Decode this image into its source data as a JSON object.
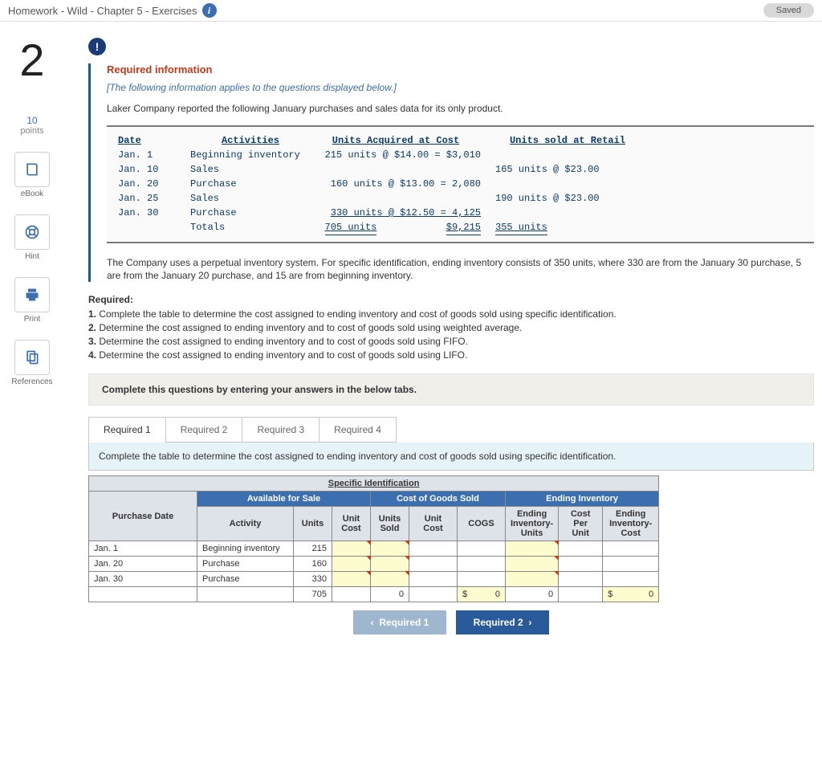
{
  "header": {
    "title": "Homework - Wild - Chapter 5 - Exercises",
    "saved": "Saved"
  },
  "side": {
    "qnum": "2",
    "points": "10",
    "pointsLabel": "points",
    "ebook": "eBook",
    "hint": "Hint",
    "print": "Print",
    "refs": "References"
  },
  "req": {
    "title": "Required information",
    "subtitle": "[The following information applies to the questions displayed below.]",
    "intro": "Laker Company reported the following January purchases and sales data for its only product."
  },
  "dt": {
    "h_date": "Date",
    "h_act": "Activities",
    "h_acq": "Units Acquired at Cost",
    "h_ret": "Units sold at Retail",
    "r1_d": "Jan.  1",
    "r1_a": "Beginning inventory",
    "r1_q": "215 units @  $14.00 = $3,010",
    "r1_r": "",
    "r2_d": "Jan. 10",
    "r2_a": "Sales",
    "r2_q": "",
    "r2_r": "165 units @  $23.00",
    "r3_d": "Jan. 20",
    "r3_a": "Purchase",
    "r3_q": "160 units @  $13.00 =  2,080",
    "r3_r": "",
    "r4_d": "Jan. 25",
    "r4_a": "Sales",
    "r4_q": "",
    "r4_r": "190 units @  $23.00",
    "r5_d": "Jan. 30",
    "r5_a": "Purchase",
    "r5_q": "330 units @  $12.50 =  4,125",
    "r5_r": "",
    "r6_a": "Totals",
    "r6_q1": "705 units",
    "r6_q2": "$9,215",
    "r6_r": "355 units"
  },
  "para2": "The Company uses a perpetual inventory system. For specific identification, ending inventory consists of 350 units, where 330 are from the January 30 purchase, 5 are from the January 20 purchase, and 15 are from beginning inventory.",
  "reqlist": {
    "hd": "Required:",
    "l1": "Complete the table to determine the cost assigned to ending inventory and cost of goods sold using specific identification.",
    "l2": "Determine the cost assigned to ending inventory and to cost of goods sold using weighted average.",
    "l3": "Determine the cost assigned to ending inventory and to cost of goods sold using FIFO.",
    "l4": "Determine the cost assigned to ending inventory and to cost of goods sold using LIFO."
  },
  "instr": "Complete this questions by entering your answers in the below tabs.",
  "tabs": {
    "t1": "Required 1",
    "t2": "Required 2",
    "t3": "Required 3",
    "t4": "Required 4"
  },
  "tabdesc": "Complete the table to determine the cost assigned to ending inventory and cost of goods sold using specific identification.",
  "sheet": {
    "title": "Specific Identification",
    "g_avail": "Available for Sale",
    "g_cogs": "Cost of Goods Sold",
    "g_end": "Ending Inventory",
    "h_pd": "Purchase Date",
    "h_act": "Activity",
    "h_units": "Units",
    "h_uc": "Unit Cost",
    "h_us": "Units Sold",
    "h_uc2": "Unit Cost",
    "h_cogs": "COGS",
    "h_eiu": "Ending Inventory-Units",
    "h_cpu": "Cost Per Unit",
    "h_eic": "Ending Inventory-Cost",
    "rows": [
      {
        "pd": "Jan. 1",
        "act": "Beginning inventory",
        "u": "215"
      },
      {
        "pd": "Jan. 20",
        "act": "Purchase",
        "u": "160"
      },
      {
        "pd": "Jan. 30",
        "act": "Purchase",
        "u": "330"
      }
    ],
    "tot_u": "705",
    "tot_us": "0",
    "tot_cogs_cur": "$",
    "tot_cogs": "0",
    "tot_eiu": "0",
    "tot_eic_cur": "$",
    "tot_eic": "0"
  },
  "nav": {
    "prev": "Required 1",
    "next": "Required 2"
  }
}
